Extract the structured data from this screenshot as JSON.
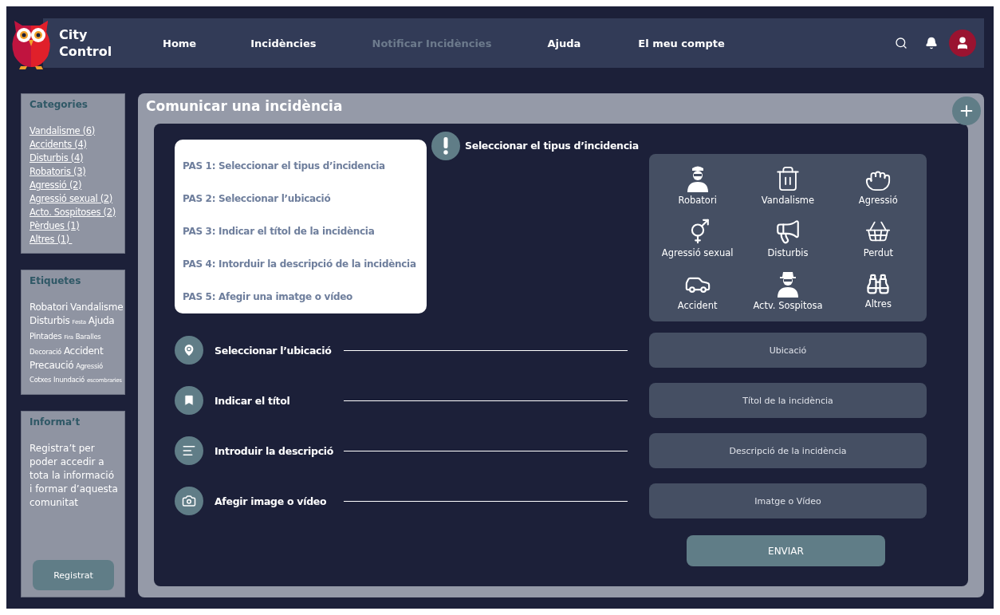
{
  "brand": {
    "name_line1": "City",
    "name_line2": "Control"
  },
  "nav": [
    {
      "label": "Home",
      "selected": false
    },
    {
      "label": "Incidències",
      "selected": false
    },
    {
      "label": "Notificar Incidències",
      "selected": true
    },
    {
      "label": "Ajuda",
      "selected": false
    },
    {
      "label": "El meu compte",
      "selected": false
    }
  ],
  "sidebar": {
    "categories": {
      "title": "Categories",
      "items": [
        "Vandalisme (6)",
        "Accidents (4)",
        "Disturbis (4)",
        "Robatoris (3)",
        "Agressió (2)",
        "Agressió sexual (2)",
        "Acto. Sospitoses (2)",
        "Pèrdues (1)",
        "Altres (1) "
      ]
    },
    "tags": {
      "title": "Etiquetes",
      "lines": [
        [
          {
            "label": "Robatori",
            "kind": "large"
          },
          {
            "label": "Vandalisme",
            "kind": "large"
          }
        ],
        [
          {
            "label": "Disturbis",
            "kind": "large"
          },
          {
            "label": "Festa",
            "kind": "tiny"
          },
          {
            "label": "Ajuda",
            "kind": "large"
          }
        ],
        [
          {
            "label": "Pintades",
            "kind": "medium"
          },
          {
            "label": "Fira",
            "kind": "tiny"
          },
          {
            "label": "Baralles",
            "kind": "small"
          }
        ],
        [
          {
            "label": "Decoració",
            "kind": "small"
          },
          {
            "label": "Accident",
            "kind": "large"
          }
        ],
        [
          {
            "label": "Precaució",
            "kind": "large"
          },
          {
            "label": "Agressió",
            "kind": "small"
          }
        ],
        [
          {
            "label": "Cotxes",
            "kind": "small"
          },
          {
            "label": "Inundació",
            "kind": "small"
          },
          {
            "label": "escombraries",
            "kind": "tiny"
          }
        ]
      ]
    },
    "info": {
      "title": "Informa’t",
      "text": "Registra’t per poder accedir a tota la informació i formar d’aquesta comunitat",
      "button": "Registrat"
    }
  },
  "main": {
    "title": "Comunicar una incidència",
    "steps": [
      "PAS 1: Seleccionar el tipus d’incidencia",
      "PAS 2: Seleccionar l’ubicació",
      "PAS 3: Indicar el títol de la incidència",
      "PAS 4: Intorduir la descripció de la incidència",
      "PAS 5: Afegir una imatge o vídeo"
    ],
    "type_heading": "Seleccionar el tipus d’incidencia",
    "types": [
      "Robatori",
      "Vandalisme",
      "Agressió",
      "Agressió sexual",
      "Disturbis",
      "Perdut",
      "Accident",
      "Actv. Sospitosa",
      "Altres"
    ],
    "rows": [
      {
        "label": "Seleccionar l’ubicació",
        "placeholder": "Ubicació"
      },
      {
        "label": "Indicar el títol",
        "placeholder": "Títol de la incidència"
      },
      {
        "label": "Introduir la descripció",
        "placeholder": "Descripció de la incidència"
      },
      {
        "label": "Afegir image o vídeo",
        "placeholder": "Imatge o Vídeo"
      }
    ],
    "submit": "ENVIAR"
  }
}
